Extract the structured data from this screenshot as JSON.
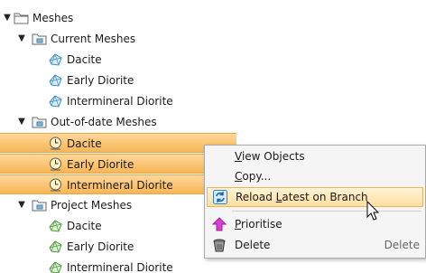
{
  "tree": {
    "root": {
      "label": "Meshes",
      "expand": "▼"
    },
    "groups": [
      {
        "label": "Current Meshes",
        "expand": "▼",
        "children": [
          "Dacite",
          "Early Diorite",
          "Intermineral Diorite"
        ]
      },
      {
        "label": "Out-of-date Meshes",
        "expand": "▼",
        "children": [
          "Dacite",
          "Early Diorite",
          "Intermineral Diorite"
        ]
      },
      {
        "label": "Project Meshes",
        "expand": "▼",
        "children": [
          "Dacite",
          "Early Diorite",
          "Intermineral Diorite"
        ]
      }
    ]
  },
  "menu": {
    "view_objects": {
      "pre": "",
      "u": "V",
      "post": "iew Objects"
    },
    "copy": {
      "pre": "",
      "u": "C",
      "post": "opy..."
    },
    "reload": {
      "pre": "Reload ",
      "u": "L",
      "post": "atest on Branch"
    },
    "prioritise": {
      "pre": "",
      "u": "P",
      "post": "rioritise"
    },
    "delete": {
      "label": "Delete",
      "shortcut": "Delete"
    }
  },
  "colors": {
    "selection": "#f6b656",
    "highlight": "#fbdfa0"
  }
}
